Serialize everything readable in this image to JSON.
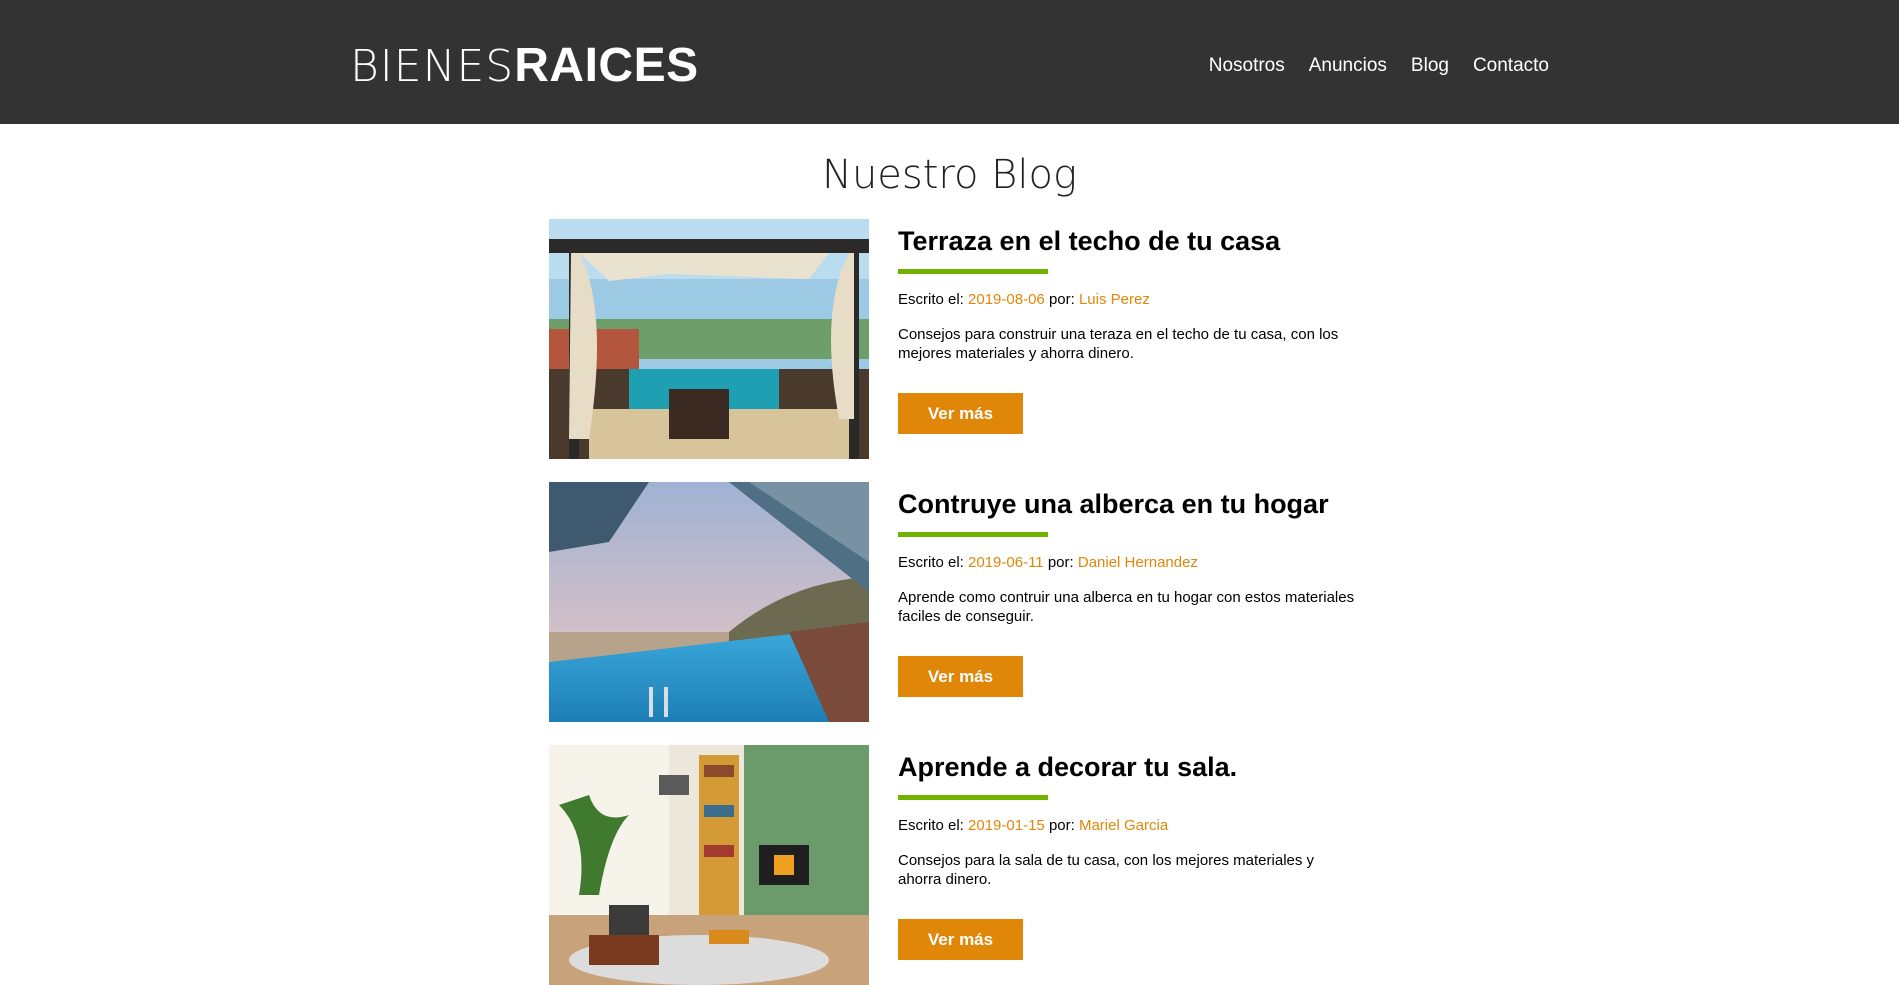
{
  "header": {
    "logo_light": "BIENES",
    "logo_bold": "RAICES",
    "nav": [
      "Nosotros",
      "Anuncios",
      "Blog",
      "Contacto"
    ]
  },
  "page_title": "Nuestro Blog",
  "posts": [
    {
      "title": "Terraza en el techo de tu casa",
      "written_label": "Escrito el:",
      "date": "2019-08-06",
      "by_label": "por:",
      "author": "Luis Perez",
      "description": "Consejos para construir una teraza en el techo de tu casa, con los mejores materiales y ahorra dinero.",
      "button": "Ver más"
    },
    {
      "title": "Contruye una alberca en tu hogar",
      "written_label": "Escrito el:",
      "date": "2019-06-11",
      "by_label": "por:",
      "author": "Daniel Hernandez",
      "description": "Aprende como contruir una alberca en tu hogar con estos materiales faciles de conseguir.",
      "button": "Ver más"
    },
    {
      "title": "Aprende a decorar tu sala.",
      "written_label": "Escrito el:",
      "date": "2019-01-15",
      "by_label": "por:",
      "author": "Mariel Garcia",
      "description": "Consejos para la sala de tu casa, con los mejores materiales y ahorra dinero.",
      "button": "Ver más"
    }
  ],
  "colors": {
    "header_bg": "#333333",
    "accent_orange": "#e08709",
    "accent_green": "#71b100"
  }
}
